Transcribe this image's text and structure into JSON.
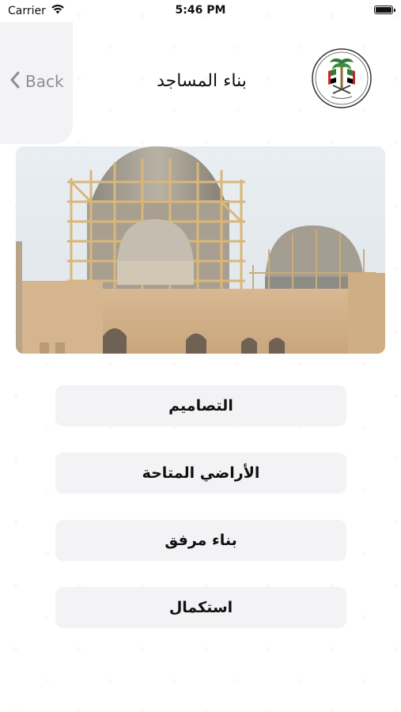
{
  "status_bar": {
    "carrier": "Carrier",
    "time": "5:46 PM",
    "wifi_icon": "wifi-icon",
    "battery_icon": "battery-icon"
  },
  "nav": {
    "back_label": "Back",
    "back_icon": "chevron-left-icon",
    "title": "بناء المساجد",
    "logo_icon": "emblem-logo"
  },
  "hero": {
    "description_icon": "mosque-construction-image"
  },
  "menu": {
    "items": [
      {
        "label": "التصاميم"
      },
      {
        "label": "الأراضي المتاحة"
      },
      {
        "label": "بناء مرفق"
      },
      {
        "label": "استكمال"
      }
    ]
  },
  "colors": {
    "button_bg": "#f3f3f5",
    "back_text": "#8e8e93",
    "text": "#111111"
  }
}
